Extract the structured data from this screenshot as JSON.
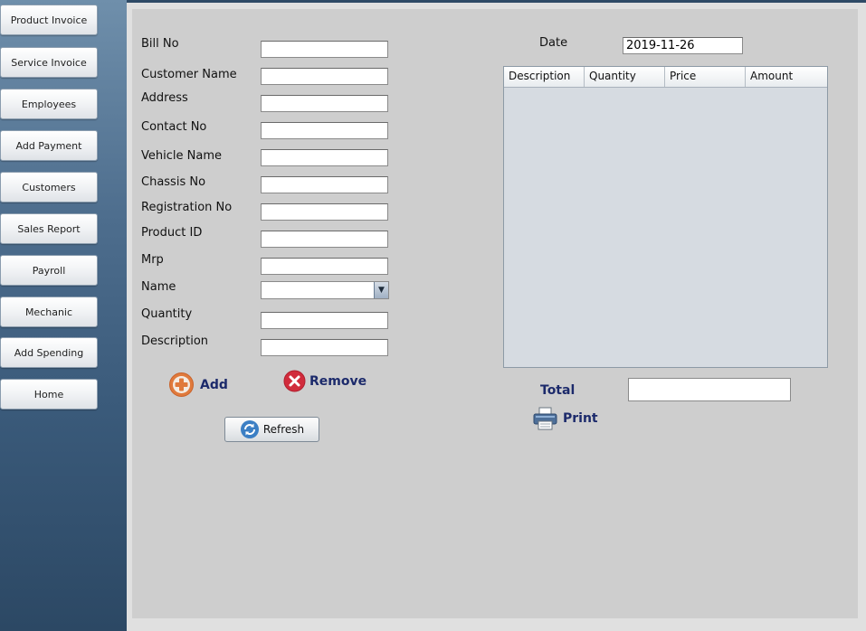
{
  "sidebar": {
    "items": [
      {
        "label": "Product Invoice"
      },
      {
        "label": "Service Invoice"
      },
      {
        "label": "Employees"
      },
      {
        "label": "Add Payment"
      },
      {
        "label": "Customers"
      },
      {
        "label": "Sales Report"
      },
      {
        "label": "Payroll"
      },
      {
        "label": "Mechanic"
      },
      {
        "label": "Add Spending"
      },
      {
        "label": "Home"
      }
    ]
  },
  "form": {
    "bill_no": {
      "label": "Bill No",
      "value": ""
    },
    "customer_name": {
      "label": "Customer Name",
      "value": ""
    },
    "address": {
      "label": "Address",
      "value": ""
    },
    "contact_no": {
      "label": "Contact No",
      "value": ""
    },
    "vehicle_name": {
      "label": "Vehicle Name",
      "value": ""
    },
    "chassis_no": {
      "label": "Chassis No",
      "value": ""
    },
    "registration_no": {
      "label": "Registration No",
      "value": ""
    },
    "product_id": {
      "label": "Product ID",
      "value": ""
    },
    "mrp": {
      "label": "Mrp",
      "value": ""
    },
    "name": {
      "label": "Name",
      "value": ""
    },
    "quantity": {
      "label": "Quantity",
      "value": ""
    },
    "description": {
      "label": "Description",
      "value": ""
    }
  },
  "actions": {
    "add_label": "Add",
    "remove_label": "Remove",
    "refresh_label": "Refresh",
    "print_label": "Print"
  },
  "date": {
    "label": "Date",
    "value": "2019-11-26"
  },
  "table": {
    "columns": [
      "Description",
      "Quantity",
      "Price",
      "Amount"
    ],
    "rows": []
  },
  "total": {
    "label": "Total",
    "value": ""
  },
  "icons": {
    "add": "add-circle-icon",
    "remove": "remove-circle-icon",
    "refresh": "refresh-icon",
    "print": "printer-icon",
    "dropdown": "chevron-down-icon"
  },
  "colors": {
    "action_text": "#1c2a6b",
    "add_icon": "#e07a3c",
    "remove_icon": "#d12c3c",
    "refresh_icon": "#3b7fc4"
  }
}
